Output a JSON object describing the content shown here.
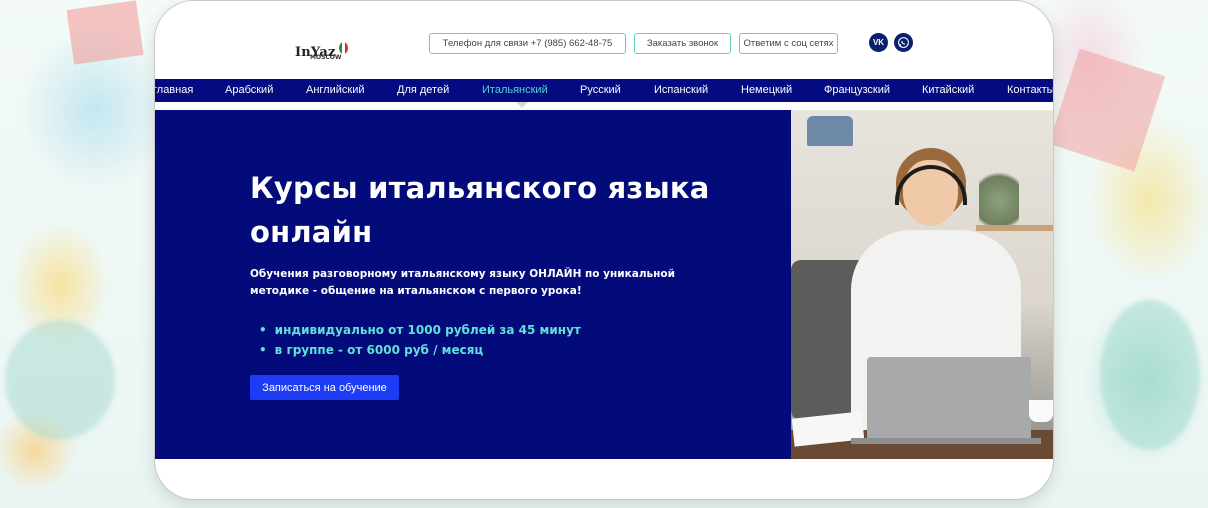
{
  "header": {
    "logo": {
      "brand": "InYaz",
      "city": "MOSCOW"
    },
    "buttons": {
      "phone": "Телефон для связи +7 (985) 662-48-75",
      "callback": "Заказать звонок",
      "social": "Ответим с соц сетях"
    },
    "social_icons": {
      "vk": "vk-icon",
      "whatsapp": "whatsapp-icon"
    },
    "vk_label": "VK",
    "wa_label": "WA"
  },
  "nav": {
    "items": [
      "главная",
      "Арабский",
      "Английский",
      "Для детей",
      "Итальянский",
      "Русский",
      "Испанский",
      "Немецкий",
      "Французский",
      "Китайский",
      "Контакты"
    ],
    "active": "Итальянский"
  },
  "hero": {
    "title": "Курсы итальянского языка онлайн",
    "subtitle": "Обучения разговорному итальянскому языку ОНЛАЙН по уникальной методике - общение на итальянском с первого урока!",
    "bullets": [
      "индивидуально от 1000 рублей за 45 минут",
      "в группе - от 6000 руб /  месяц"
    ],
    "cta": "Записаться на обучение"
  },
  "colors": {
    "nav_bg": "#040a80",
    "hero_bg": "#030b7a",
    "accent": "#4fd6d8",
    "cta": "#1d3cf5",
    "button_border": "#5fd3c2"
  }
}
